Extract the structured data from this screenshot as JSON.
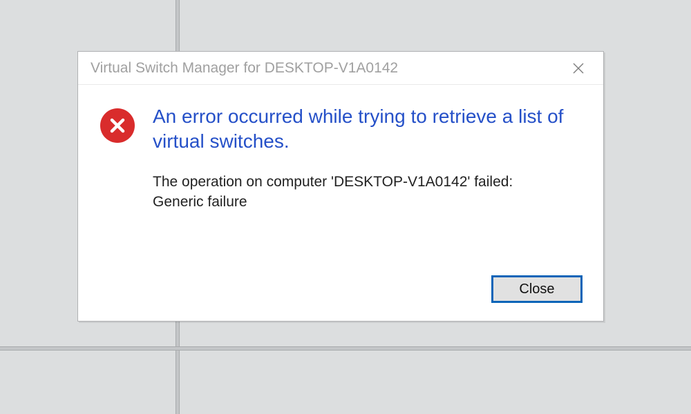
{
  "dialog": {
    "title": "Virtual Switch Manager for DESKTOP-V1A0142",
    "headline": "An error occurred while trying to retrieve a list of virtual switches.",
    "details": "The operation on computer 'DESKTOP-V1A0142' failed: Generic failure",
    "close_button_label": "Close"
  }
}
